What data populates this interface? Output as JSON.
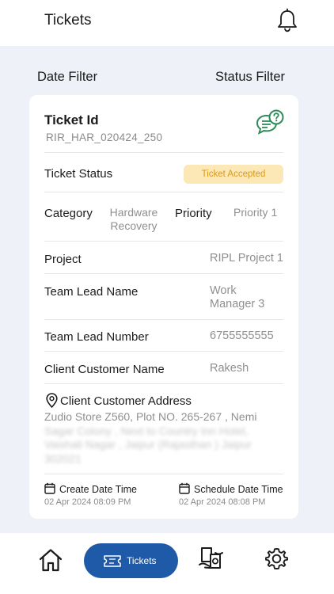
{
  "header": {
    "title": "Tickets",
    "bell_icon": "bell-icon"
  },
  "filters": {
    "date_label": "Date Filter",
    "status_label": "Status Filter"
  },
  "ticket": {
    "id_title": "Ticket Id",
    "id_value": "RIR_HAR_020424_250",
    "chat_icon": "chat-bubbles-icon",
    "status_label": "Ticket Status",
    "status_value": "Ticket Accepted",
    "category_label": "Category",
    "category_value": "Hardware Recovery",
    "priority_label": "Priority",
    "priority_value": "Priority 1",
    "project_label": "Project",
    "project_value": "RIPL Project 1",
    "team_lead_label": "Team Lead Name",
    "team_lead_value": "Work Manager 3",
    "team_lead_number_label": "Team Lead Number",
    "team_lead_number_value": "6755555555",
    "client_name_label": "Client Customer Name",
    "client_name_value": "Rakesh",
    "address_label": "Client Customer Address",
    "address_lines": [
      "Zudio Store Z560, Plot NO. 265-267 , Nemi",
      "Sagar Colony , Next to Country Inn Hotel,",
      "Vaishali Nagar , Jaipur (Rajasthan ) Jaipur",
      "302021"
    ],
    "create_label": "Create Date Time",
    "create_value": "02 Apr 2024 08:09 PM",
    "schedule_label": "Schedule Date Time",
    "schedule_value": "02 Apr 2024 08:08 PM"
  },
  "nav": {
    "home_icon": "home-icon",
    "tickets_label": "Tickets",
    "handover_icon": "handover-icon",
    "settings_icon": "settings-icon"
  },
  "colors": {
    "primary": "#1e5aa8",
    "badge_bg": "#fce7b6",
    "badge_text": "#d89a20",
    "chat_icon": "#2e8b57",
    "background": "#eef1f7"
  }
}
